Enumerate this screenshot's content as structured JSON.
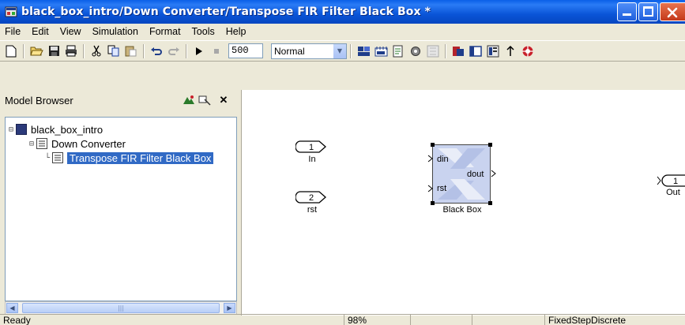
{
  "window": {
    "title": "black_box_intro/Down Converter/Transpose FIR Filter Black Box *"
  },
  "menu": [
    "File",
    "Edit",
    "View",
    "Simulation",
    "Format",
    "Tools",
    "Help"
  ],
  "toolbar": {
    "stop_time": "500",
    "sim_mode": "Normal"
  },
  "browser": {
    "title": "Model Browser",
    "tree": [
      {
        "label": "black_box_intro",
        "expander": "⊟"
      },
      {
        "label": "Down Converter",
        "expander": "⊟"
      },
      {
        "label": "Transpose FIR Filter Black Box",
        "selected": true
      }
    ]
  },
  "canvas": {
    "inports": [
      {
        "number": "1",
        "label": "In"
      },
      {
        "number": "2",
        "label": "rst"
      }
    ],
    "outport": {
      "number": "1",
      "label": "Out"
    },
    "block": {
      "label": "Black Box",
      "input_ports": [
        "din",
        "rst"
      ],
      "output_port": "dout"
    }
  },
  "status": {
    "state": "Ready",
    "zoom": "98%",
    "solver": "FixedStepDiscrete"
  },
  "colors": {
    "title_bar": "#0a55d8",
    "selection": "#316ac5",
    "block_fill": "#c9d3ef"
  }
}
